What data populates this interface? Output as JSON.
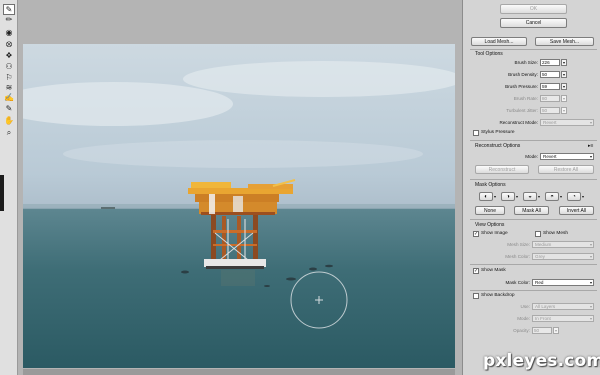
{
  "toolbar": {
    "tools": [
      {
        "icon": "forward-warp-icon",
        "glyph": "✎"
      },
      {
        "icon": "reconstruct-icon",
        "glyph": "✏"
      },
      {
        "icon": "twirl-icon",
        "glyph": "◉"
      },
      {
        "icon": "pucker-icon",
        "glyph": "⭙"
      },
      {
        "icon": "bloat-icon",
        "glyph": "❖"
      },
      {
        "icon": "push-left-icon",
        "glyph": "⚇"
      },
      {
        "icon": "mirror-icon",
        "glyph": "⚐"
      },
      {
        "icon": "turbulence-icon",
        "glyph": "≋"
      },
      {
        "icon": "freeze-mask-icon",
        "glyph": "✍"
      },
      {
        "icon": "thaw-mask-icon",
        "glyph": "✎"
      },
      {
        "icon": "hand-icon",
        "glyph": "✋"
      },
      {
        "icon": "zoom-icon",
        "glyph": "⌕"
      }
    ]
  },
  "buttons": {
    "ok": "OK",
    "cancel": "Cancel",
    "load_mesh": "Load Mesh...",
    "save_mesh": "Save Mesh..."
  },
  "tool_options": {
    "title": "Tool Options",
    "brush_size": {
      "label": "Brush Size:",
      "value": "226"
    },
    "brush_density": {
      "label": "Brush Density:",
      "value": "50"
    },
    "brush_pressure": {
      "label": "Brush Pressure:",
      "value": "59"
    },
    "brush_rate": {
      "label": "Brush Rate:",
      "value": "80"
    },
    "turbulent_jitter": {
      "label": "Turbulent Jitter:",
      "value": "50"
    },
    "reconstruct_mode": {
      "label": "Reconstruct Mode:",
      "value": "Revert"
    },
    "stylus_pressure": "Stylus Pressure"
  },
  "reconstruct_options": {
    "title": "Reconstruct Options",
    "mode_label": "Mode:",
    "mode_value": "Revert",
    "reconstruct": "Reconstruct",
    "restore_all": "Restore All"
  },
  "mask_options": {
    "title": "Mask Options",
    "none": "None",
    "mask_all": "Mask All",
    "invert_all": "Invert All"
  },
  "view_options": {
    "title": "View Options",
    "show_image": "Show Image",
    "show_mesh": "Show Mesh",
    "mesh_size_label": "Mesh Size:",
    "mesh_size_value": "Medium",
    "mesh_color_label": "Mesh Color:",
    "mesh_color_value": "Grey",
    "show_mask": "Show Mask",
    "mask_color_label": "Mask Color:",
    "mask_color_value": "Red",
    "show_backdrop": "Show Backdrop",
    "use_label": "Use:",
    "use_value": "All Layers",
    "backdrop_mode_label": "Mode:",
    "backdrop_mode_value": "In Front",
    "opacity_label": "Opacity:",
    "opacity_value": "50"
  },
  "checkbox_states": {
    "stylus_pressure": false,
    "show_image": true,
    "show_mesh": false,
    "show_mask": true,
    "show_backdrop": false
  },
  "watermark": "pxleyes.com"
}
